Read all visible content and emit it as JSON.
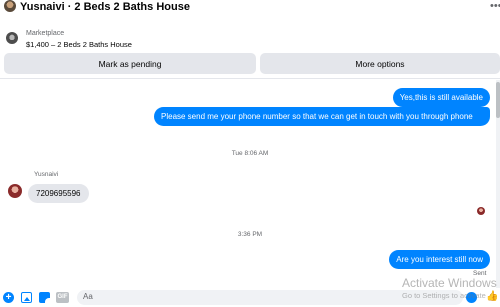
{
  "header": {
    "title": "Yusnaivi · 2 Beds 2 Baths House",
    "menu_icon": "more-dots-icon"
  },
  "listing": {
    "source": "Marketplace",
    "name": "$1,400 – 2 Beds 2 Baths House"
  },
  "actions": {
    "pending_label": "Mark as pending",
    "more_label": "More options"
  },
  "thread": {
    "messages": [
      {
        "direction": "out",
        "text": "Yes,this is still available"
      },
      {
        "direction": "out",
        "text": "Please send me your phone  number so that we can get in touch with you through phone"
      },
      {
        "direction": "in",
        "sender": "Yusnaivi",
        "text": "7209695596"
      },
      {
        "direction": "out",
        "text": "Are you interest still now"
      }
    ],
    "timestamps": [
      "Tue 8:06 AM",
      "3:36 PM"
    ],
    "sent_label": "Sent"
  },
  "composer": {
    "placeholder": "Aa",
    "gif_label": "GIF",
    "icons": [
      "plus-icon",
      "photo-icon",
      "sticker-icon",
      "gif-icon",
      "emoji-icon",
      "like-icon"
    ]
  },
  "watermark": {
    "line1": "Activate Windows",
    "line2": "Go to Settings to activate"
  },
  "colors": {
    "accent": "#0084ff",
    "bubble_in": "#e4e6eb",
    "button_bg": "#e4e6eb"
  }
}
